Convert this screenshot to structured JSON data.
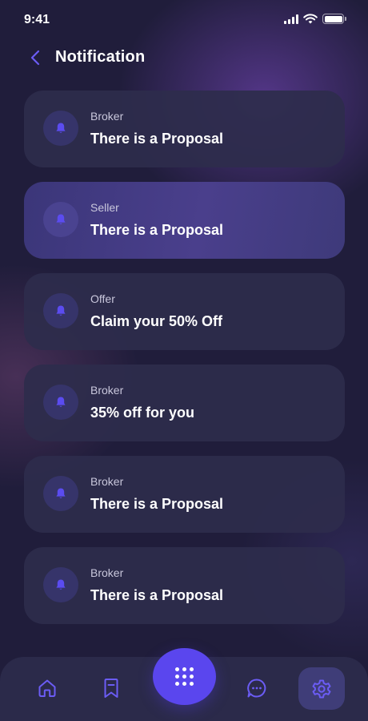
{
  "status_bar": {
    "time": "9:41"
  },
  "header": {
    "title": "Notification"
  },
  "notifications": [
    {
      "sender": "Broker",
      "message": "There is a Proposal"
    },
    {
      "sender": "Seller",
      "message": "There is a Proposal",
      "active": true
    },
    {
      "sender": "Offer",
      "message": "Claim your 50% Off"
    },
    {
      "sender": "Broker",
      "message": "35% off for you"
    },
    {
      "sender": "Broker",
      "message": "There is a Proposal"
    },
    {
      "sender": "Broker",
      "message": "There is a Proposal"
    }
  ],
  "bottom_nav": {
    "items": [
      "home-icon",
      "bookmark-icon",
      "grid-menu-icon",
      "chat-icon",
      "settings-icon"
    ],
    "selected": "settings-icon"
  },
  "colors": {
    "background": "#201d3b",
    "card": "#2e2d4c",
    "card_active": "#4a3f8c",
    "accent": "#5a46ee",
    "icon": "#5b4cf0"
  }
}
